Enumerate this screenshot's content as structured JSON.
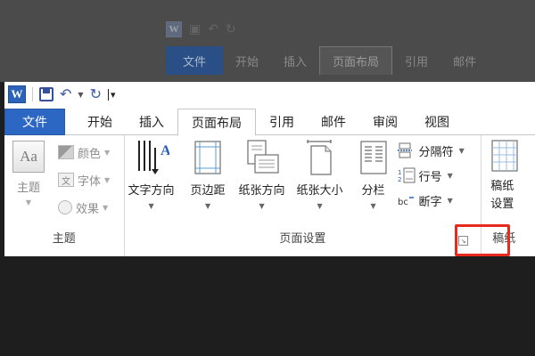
{
  "background": {
    "qat": {
      "app_icon_letter": "W"
    },
    "tabs": [
      "文件",
      "开始",
      "插入",
      "页面布局",
      "引用",
      "邮件"
    ]
  },
  "qat": {
    "app_icon_letter": "W",
    "items": [
      "word-logo-icon",
      "save-icon",
      "undo-icon",
      "redo-icon",
      "customize-qat-icon"
    ]
  },
  "tabs": [
    {
      "label": "文件"
    },
    {
      "label": "开始"
    },
    {
      "label": "插入"
    },
    {
      "label": "页面布局"
    },
    {
      "label": "引用"
    },
    {
      "label": "邮件"
    },
    {
      "label": "审阅"
    },
    {
      "label": "视图"
    }
  ],
  "active_tab": "页面布局",
  "groups": {
    "theme": {
      "label": "主题",
      "theme_button": "主题",
      "theme_icon_text": "Aa",
      "items": [
        {
          "label": "颜色"
        },
        {
          "label": "字体",
          "icon_text": "文"
        },
        {
          "label": "效果"
        }
      ]
    },
    "page_setup": {
      "label": "页面设置",
      "buttons": [
        {
          "label": "文字方向"
        },
        {
          "label": "页边距"
        },
        {
          "label": "纸张方向"
        },
        {
          "label": "纸张大小"
        },
        {
          "label": "分栏"
        }
      ],
      "small_items": [
        {
          "label": "分隔符"
        },
        {
          "label": "行号"
        },
        {
          "label": "断字"
        }
      ]
    },
    "manuscript": {
      "label": "稿纸",
      "button_line1": "稿纸",
      "button_line2": "设置"
    }
  },
  "colors": {
    "file_tab": "#2c67c3",
    "highlight_box": "#e8291c",
    "overlay": "#1e1e1e"
  }
}
